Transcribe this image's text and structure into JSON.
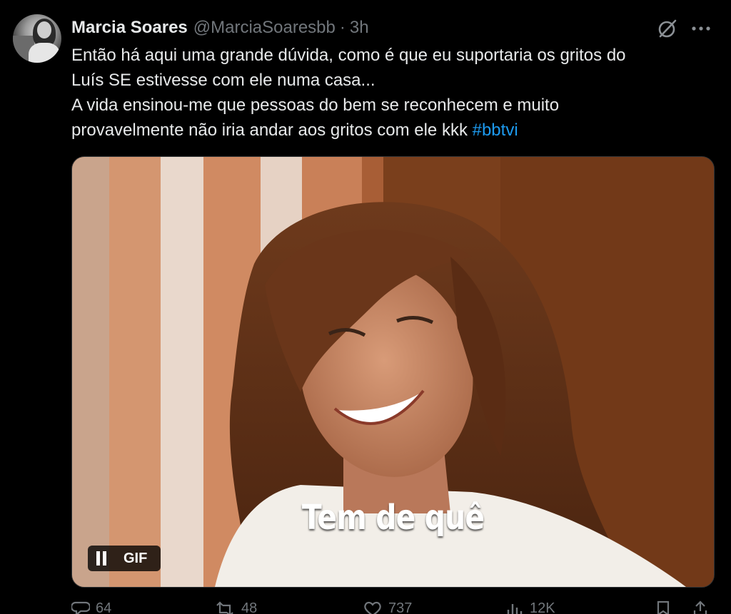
{
  "tweet": {
    "author": {
      "display_name": "Marcia Soares",
      "handle": "@MarciaSoaresbb",
      "separator": "·",
      "time": "3h"
    },
    "text_lines": [
      "Então há aqui uma grande dúvida, como é que eu suportaria os gritos do",
      "Luís SE estivesse com ele numa casa...",
      "A vida ensinou-me que pessoas do bem se reconhecem e muito",
      "provavelmente não iria andar aos gritos com ele kkk "
    ],
    "hashtag": "#bbtvi",
    "media": {
      "caption": "Tem de quê",
      "badge": "GIF"
    },
    "actions": {
      "replies": "64",
      "reposts": "48",
      "likes": "737",
      "views": "12K"
    }
  },
  "icons": {
    "header": [
      "grok-icon",
      "more-icon"
    ],
    "actions": [
      "reply-icon",
      "repost-icon",
      "like-icon",
      "views-icon",
      "bookmark-icon",
      "share-icon"
    ]
  },
  "colors": {
    "background": "#000000",
    "text": "#e7e9ea",
    "secondary": "#71767b",
    "link": "#1d9bf0"
  }
}
